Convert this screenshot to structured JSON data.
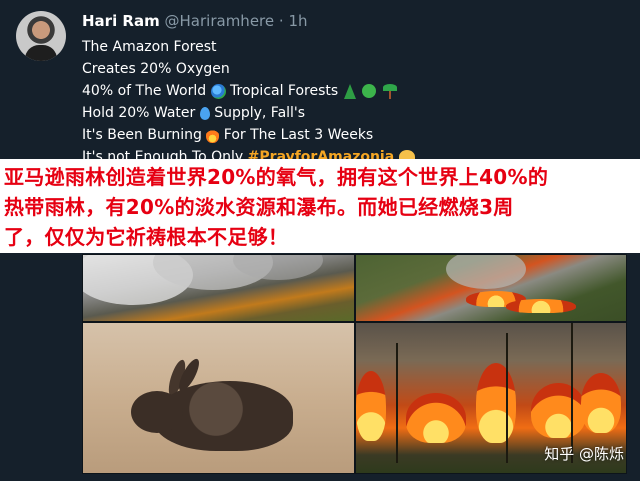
{
  "author": {
    "name": "Hari Ram",
    "handle": "@Hariramhere",
    "separator": "·",
    "time": "1h"
  },
  "tweet": {
    "line1": "The Amazon Forest",
    "line2": "Creates 20% Oxygen",
    "line3_a": "40% of The World",
    "line3_b": "Tropical Forests",
    "line4_a": "Hold 20% Water",
    "line4_b": "Supply, Fall's",
    "line5_a": "It's Been Burning",
    "line5_b": "For The Last 3 Weeks",
    "line6_a": "It's not Enough To Only",
    "hashtag": "#PrayforAmazonia",
    "icons": [
      "globe-icon",
      "evergreen-tree-icon",
      "deciduous-tree-icon",
      "palm-tree-icon",
      "droplet-icon",
      "fire-icon",
      "praying-hands-icon"
    ]
  },
  "banner": {
    "line1": "亚马逊雨林创造着世界20%的氧气，拥有这个世界上40%的",
    "line2": "热带雨林，有20%的淡水资源和瀑布。而她已经燃烧3周",
    "line3": "了，仅仅为它祈祷根本不足够！",
    "color": "#e60012"
  },
  "watermark": "知乎 @陈烁",
  "colors": {
    "background": "#15202b",
    "secondary_text": "#8899a6",
    "hashtag": "#f5a623"
  }
}
